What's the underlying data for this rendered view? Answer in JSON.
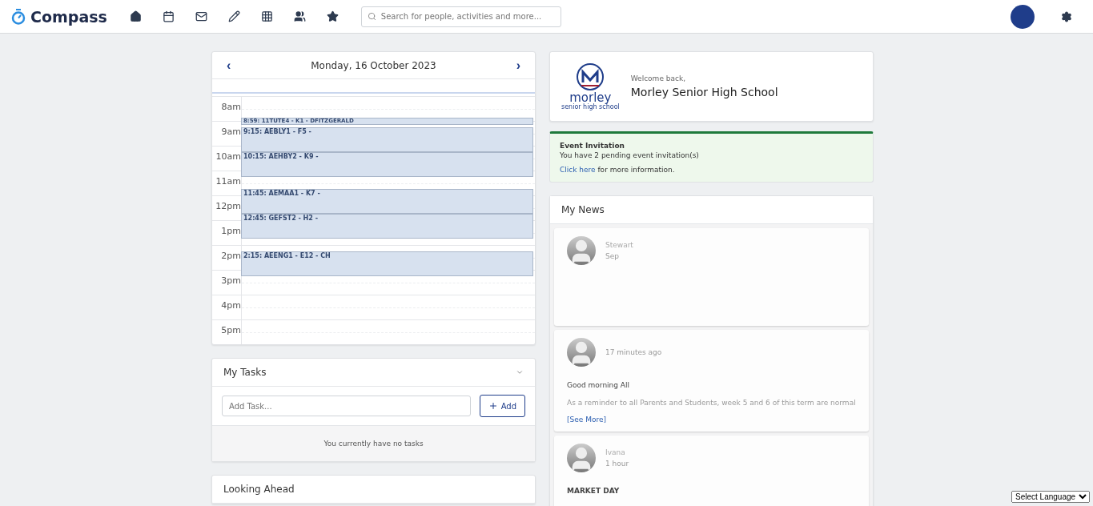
{
  "brand": {
    "name": "Compass"
  },
  "search": {
    "placeholder": "Search for people, activities and more..."
  },
  "calendar": {
    "date": "Monday, 16 October 2023",
    "prev": "‹",
    "next": "›",
    "hours": [
      "8am",
      "9am",
      "10am",
      "11am",
      "12pm",
      "1pm",
      "2pm",
      "3pm",
      "4pm",
      "5pm"
    ],
    "events": [
      {
        "label": "8:59: 11TUTE4 - K1 - DFITZGERALD",
        "kind": "tutorial"
      },
      {
        "label": "9:15: AEBLY1 - F5 -",
        "kind": "lesson"
      },
      {
        "label": "10:15: AEHBY2 - K9 -",
        "kind": "lesson"
      },
      {
        "label": "11:45: AEMAA1 - K7 -",
        "kind": "lesson"
      },
      {
        "label": "12:45: GEFST2 - H2 -",
        "kind": "lesson"
      },
      {
        "label": "2:15: AEENG1 - E12 - CH",
        "kind": "lesson"
      }
    ]
  },
  "tasks": {
    "title": "My Tasks",
    "placeholder": "Add Task...",
    "add": "Add",
    "empty": "You currently have no tasks"
  },
  "looking_ahead": {
    "title": "Looking Ahead"
  },
  "welcome": {
    "greeting": "Welcome back,",
    "school": "Morley Senior High School",
    "logo_word": "morley",
    "logo_sub": "senior high school"
  },
  "invitation": {
    "title": "Event Invitation",
    "message": "You have 2 pending event invitation(s)",
    "link": "Click here",
    "rest": " for more information."
  },
  "news": {
    "title": "My News",
    "items": [
      {
        "author": "Stewart",
        "time": "Sep"
      },
      {
        "time": "17 minutes ago",
        "lines": [
          "Good morning All",
          "As a reminder to all Parents and Students, week 5 and 6 of this term are normal"
        ],
        "see_more": "[See More]"
      },
      {
        "author": "Ivana",
        "time": "1 hour",
        "lines": [
          "MARKET DAY"
        ]
      }
    ]
  },
  "language": {
    "label": "Select Language"
  }
}
